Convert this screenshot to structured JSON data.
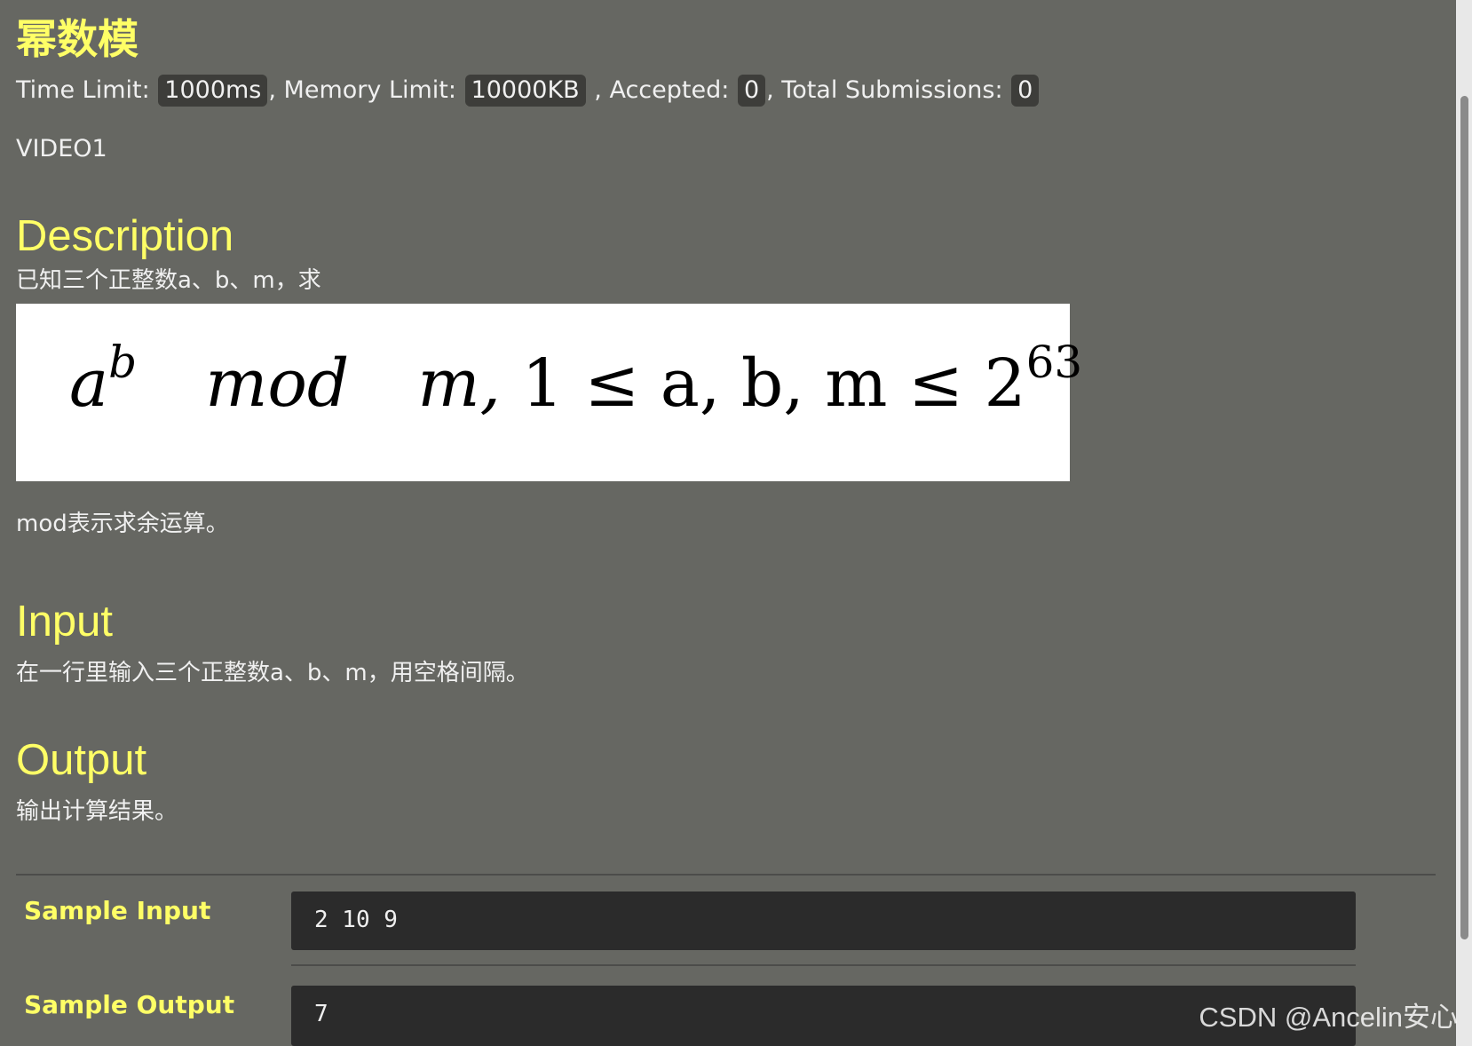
{
  "problem": {
    "title": "幂数模",
    "limits": {
      "time_label": "Time Limit:",
      "time_value": "1000ms",
      "memory_label": ", Memory Limit:",
      "memory_value": "10000KB",
      "accepted_label": ", Accepted:",
      "accepted_value": "0",
      "total_label": ", Total Submissions:",
      "total_value": "0"
    },
    "video": "VIDEO1"
  },
  "description": {
    "title": "Description",
    "intro": "已知三个正整数a、b、m，求",
    "formula": {
      "base": "a",
      "exp": "b",
      "op": "mod",
      "mod_var": "m,",
      "constraint": "1 ≤ a, b, m ≤ 2",
      "constraint_exp": "63"
    },
    "note": "mod表示求余运算。"
  },
  "input": {
    "title": "Input",
    "text": "在一行里输入三个正整数a、b、m，用空格间隔。"
  },
  "output": {
    "title": "Output",
    "text": "输出计算结果。"
  },
  "samples": {
    "input_label": "Sample Input",
    "input_value": "2 10 9",
    "output_label": "Sample Output",
    "output_value": "7"
  },
  "watermark": "CSDN @Ancelin安心"
}
